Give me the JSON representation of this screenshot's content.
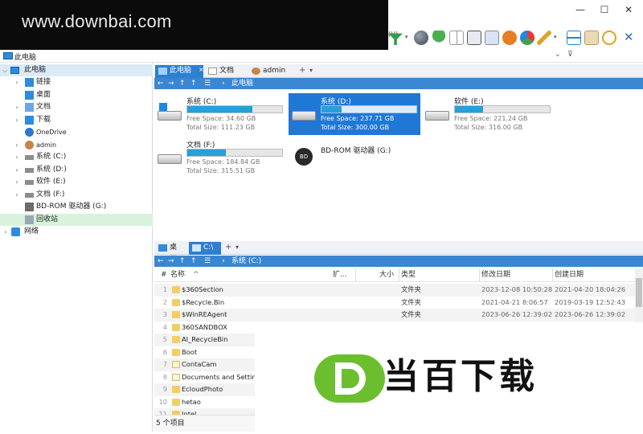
{
  "watermark": {
    "text": "www.downbai.com"
  },
  "window": {
    "minimize": "—",
    "maximize": "☐",
    "close": "✕"
  },
  "address": {
    "path": "此电脑",
    "dropdown": "⌄",
    "filter": "⊽"
  },
  "tree": {
    "root": "此电脑",
    "items": [
      {
        "label": "链接",
        "icon": "link-icon",
        "arrow": true
      },
      {
        "label": "桌面",
        "icon": "desktop-icon",
        "arrow": false
      },
      {
        "label": "文档",
        "icon": "documents-icon",
        "arrow": true
      },
      {
        "label": "下载",
        "icon": "download-icon",
        "arrow": true
      },
      {
        "label": "OneDrive",
        "icon": "cloud-icon",
        "arrow": false
      },
      {
        "label": "admin",
        "icon": "user-icon",
        "arrow": true
      },
      {
        "label": "系统 (C:)",
        "icon": "drive-icon",
        "arrow": true
      },
      {
        "label": "系统 (D:)",
        "icon": "drive-icon",
        "arrow": true
      },
      {
        "label": "软件 (E:)",
        "icon": "drive-icon",
        "arrow": true
      },
      {
        "label": "文档 (F:)",
        "icon": "drive-icon",
        "arrow": true
      },
      {
        "label": "BD-ROM 驱动器 (G:)",
        "icon": "disc-icon",
        "arrow": false
      },
      {
        "label": "回收站",
        "icon": "recycle-bin-icon",
        "arrow": false
      }
    ],
    "network": "网络"
  },
  "top_pane": {
    "tabs": [
      "此电脑",
      "文档",
      "admin"
    ],
    "breadcrumb": "此电脑",
    "drives": [
      {
        "name": "系统 (C:)",
        "free": "Free Space: 34.60 GB",
        "total": "Total Size: 111.23 GB",
        "used_fraction": 0.69,
        "selected": false
      },
      {
        "name": "系统 (D:)",
        "free": "Free Space: 237.71 GB",
        "total": "Total Size: 300.00 GB",
        "used_fraction": 0.21,
        "selected": true
      },
      {
        "name": "软件 (E:)",
        "free": "Free Space: 221.24 GB",
        "total": "Total Size: 316.00 GB",
        "used_fraction": 0.3,
        "selected": false
      },
      {
        "name": "文档 (F:)",
        "free": "Free Space: 184.84 GB",
        "total": "Total Size: 315.51 GB",
        "used_fraction": 0.41,
        "selected": false
      },
      {
        "name": "BD-ROM 驱动器 (G:)",
        "disc_label": "BD",
        "selected": false
      }
    ]
  },
  "bottom_pane": {
    "tabs": [
      "桌面",
      "C:\\"
    ],
    "breadcrumb": "系统 (C:)",
    "columns": {
      "index": "#",
      "name": "名称",
      "ext": "扩...",
      "size": "大小",
      "type": "类型",
      "modified": "修改日期",
      "created": "创建日期"
    },
    "rows": [
      {
        "n": "1",
        "name": "$360Section",
        "type": "文件夹",
        "modified": "2023-12-08 10:50:28",
        "created": "2021-04-20 18:04:26"
      },
      {
        "n": "2",
        "name": "$Recycle.Bin",
        "type": "文件夹",
        "modified": "2021-04-21 8:06:57",
        "created": "2019-03-19 12:52:43"
      },
      {
        "n": "3",
        "name": "$WinREAgent",
        "type": "文件夹",
        "modified": "2023-06-26 12:39:02",
        "created": "2023-06-26 12:39:02"
      },
      {
        "n": "4",
        "name": "360SANDBOX"
      },
      {
        "n": "5",
        "name": "AI_RecycleBin"
      },
      {
        "n": "6",
        "name": "Boot"
      },
      {
        "n": "7",
        "name": "ContaCam"
      },
      {
        "n": "8",
        "name": "Documents and Settings"
      },
      {
        "n": "9",
        "name": "EcloudPhoto"
      },
      {
        "n": "10",
        "name": "hetao"
      },
      {
        "n": "11",
        "name": "Intel"
      }
    ],
    "status": "5 个项目"
  },
  "logo": {
    "text": "当百下载"
  }
}
